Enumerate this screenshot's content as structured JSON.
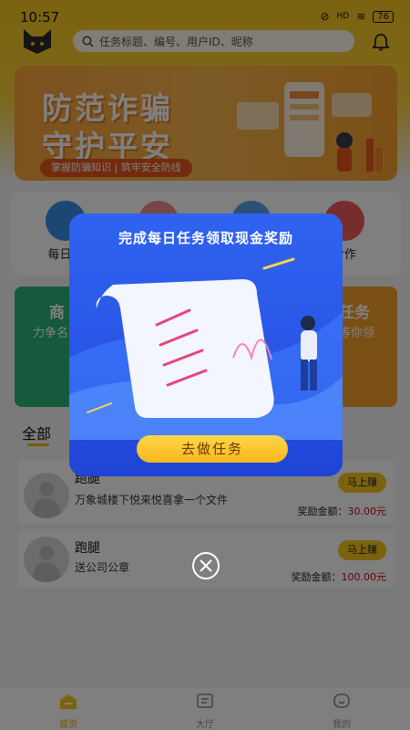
{
  "status_bar": {
    "time": "10:57",
    "signal_text": "HD",
    "battery": "76"
  },
  "header": {
    "search_placeholder": "任务标题、编号、用户ID、昵称"
  },
  "banner": {
    "line1": "防范诈骗",
    "line2": "守护平安",
    "tagline": "掌握防骗知识 | 筑牢安全防线"
  },
  "quick_items": [
    {
      "label": "每日签",
      "icon": "calendar-icon",
      "color": "#3a8ee6"
    },
    {
      "label": "",
      "icon": "gift-icon",
      "color": "#f08c8c"
    },
    {
      "label": "",
      "icon": "chat-icon",
      "color": "#5aa0f2"
    },
    {
      "label": "合作",
      "icon": "handshake-icon",
      "color": "#f05a5a"
    }
  ],
  "cards": [
    {
      "title": "商",
      "subtitle": "力争名",
      "color": "#2bb57a"
    },
    {
      "title": "任务",
      "subtitle": "等你领",
      "color": "#f59f2c"
    }
  ],
  "tabs": {
    "all": "全部"
  },
  "tasks": [
    {
      "title": "跑腿",
      "desc": "万象城楼下悦来悦喜拿一个文件",
      "button": "马上赚",
      "reward_label": "奖励金额：",
      "reward_amount": "30.00元"
    },
    {
      "title": "跑腿",
      "desc": "送公司公章",
      "button": "马上赚",
      "reward_label": "奖励金额：",
      "reward_amount": "100.00元"
    }
  ],
  "bottom_nav": [
    {
      "label": "首页",
      "icon": "home-icon",
      "active": true
    },
    {
      "label": "大厅",
      "icon": "hall-icon",
      "active": false
    },
    {
      "label": "我的",
      "icon": "profile-icon",
      "active": false
    }
  ],
  "modal": {
    "title": "完成每日任务领取现金奖励",
    "cta": "去做任务"
  },
  "colors": {
    "accent": "#f7c51e",
    "modal_blue": "#2a56e6",
    "reward_red": "#d0021b"
  }
}
